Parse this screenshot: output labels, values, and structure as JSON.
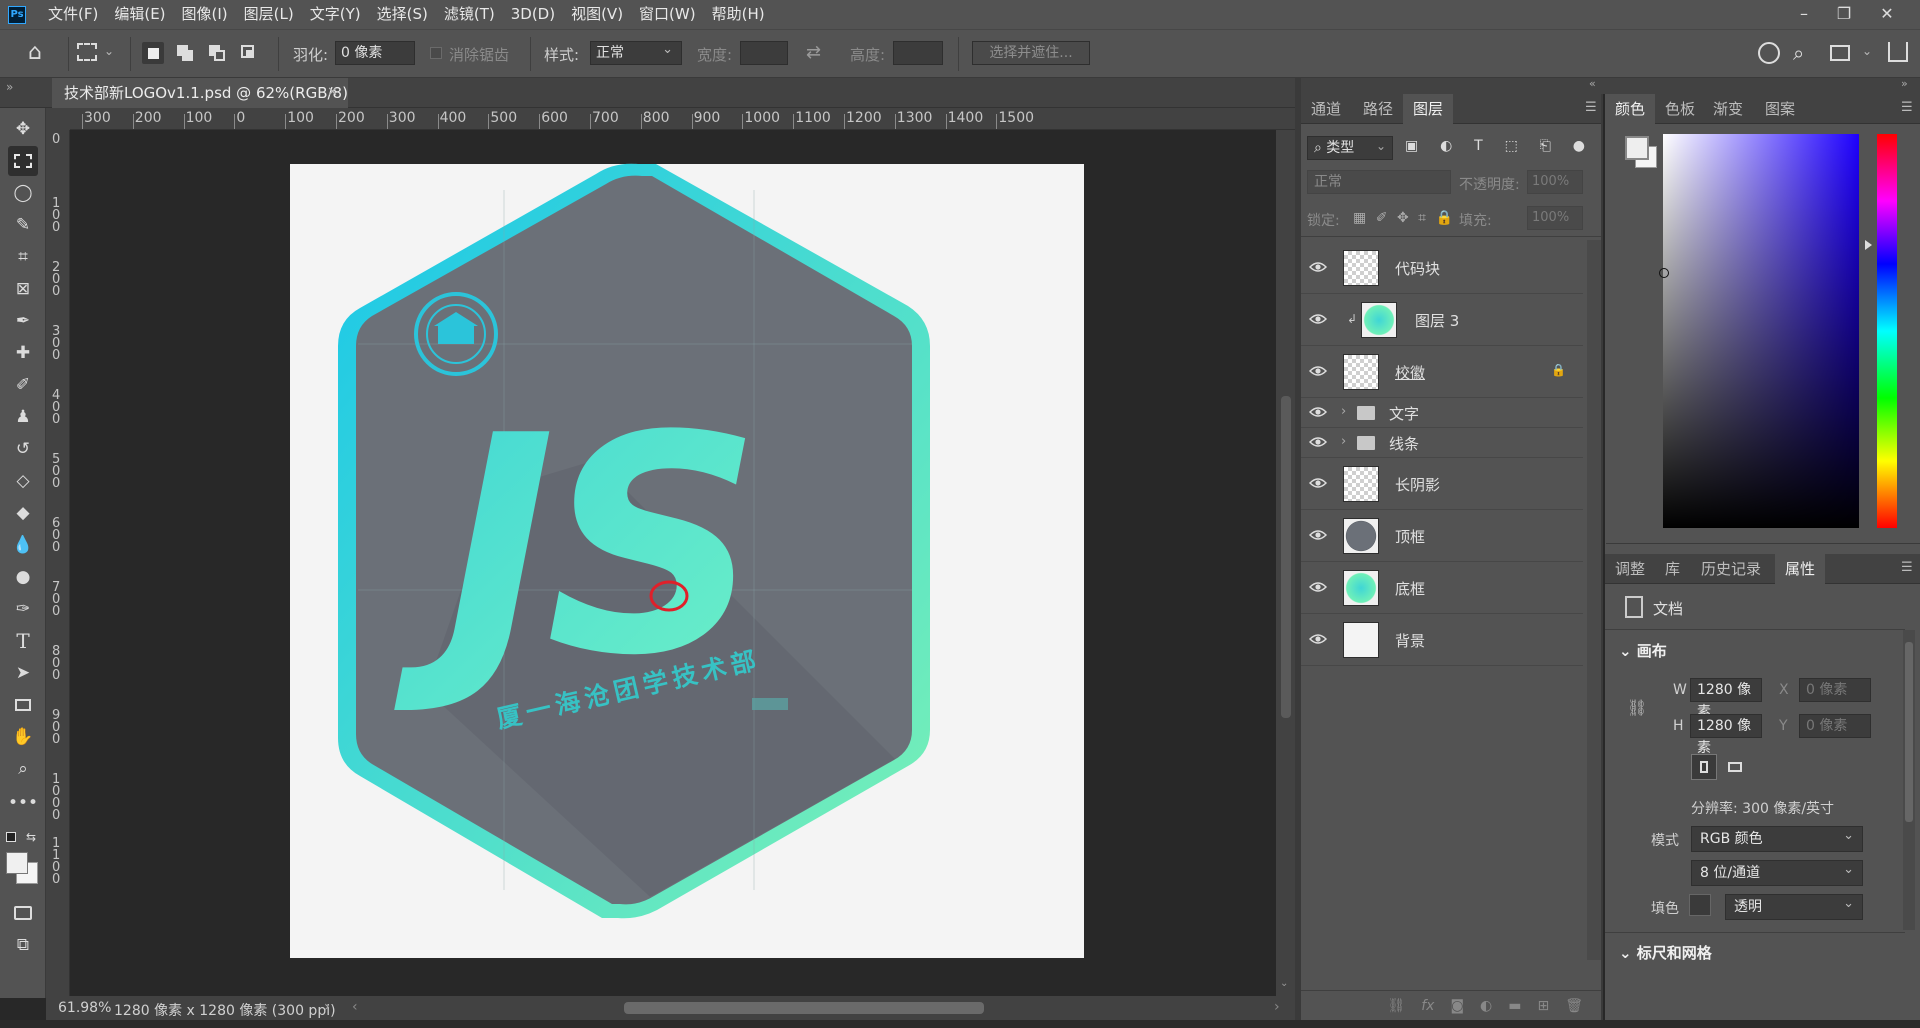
{
  "app": {
    "logo": "Ps"
  },
  "menu": [
    "文件(F)",
    "编辑(E)",
    "图像(I)",
    "图层(L)",
    "文字(Y)",
    "选择(S)",
    "滤镜(T)",
    "3D(D)",
    "视图(V)",
    "窗口(W)",
    "帮助(H)"
  ],
  "options": {
    "feather_label": "羽化:",
    "feather_value": "0 像素",
    "antialias_label": "消除锯齿",
    "style_label": "样式:",
    "style_value": "正常",
    "width_label": "宽度:",
    "height_label": "高度:",
    "select_mask_button": "选择并遮住..."
  },
  "document": {
    "tab_title": "技术部新LOGOv1.1.psd @ 62%(RGB/8)"
  },
  "ruler": {
    "h": [
      "300",
      "200",
      "100",
      "0",
      "100",
      "200",
      "300",
      "400",
      "500",
      "600",
      "700",
      "800",
      "900",
      "1000",
      "1100",
      "1200",
      "1300",
      "1400",
      "1500"
    ],
    "v": [
      "0",
      "1\n0\n0",
      "2\n0\n0",
      "3\n0\n0",
      "4\n0\n0",
      "5\n0\n0",
      "6\n0\n0",
      "7\n0\n0",
      "8\n0\n0",
      "9\n0\n0",
      "1\n0\n0\n0",
      "1\n1\n0\n0"
    ]
  },
  "artwork": {
    "logo_text": "JS",
    "subtitle": "厦一海沧团学技术部"
  },
  "status": {
    "zoom": "61.98%",
    "doc_info": "1280 像素 x 1280 像素 (300 ppi)"
  },
  "layers_panel": {
    "tabs": [
      "通道",
      "路径",
      "图层"
    ],
    "active_tab": "图层",
    "filter_type": "类型",
    "blend_mode": "正常",
    "opacity_label": "不透明度:",
    "opacity_value": "100%",
    "lock_label": "锁定:",
    "fill_label": "填充:",
    "fill_value": "100%",
    "layers": [
      {
        "name": "代码块",
        "thumb": "checker",
        "visible": true
      },
      {
        "name": "图层 3",
        "thumb": "gradient-hex",
        "visible": true,
        "clipped": true
      },
      {
        "name": "校徽",
        "thumb": "checker",
        "visible": true,
        "locked": true
      },
      {
        "name": "文字",
        "thumb": "folder",
        "visible": true
      },
      {
        "name": "线条",
        "thumb": "folder",
        "visible": true
      },
      {
        "name": "长阴影",
        "thumb": "checker",
        "visible": true
      },
      {
        "name": "顶框",
        "thumb": "gray-hex",
        "visible": true
      },
      {
        "name": "底框",
        "thumb": "gradient-hex",
        "visible": true
      },
      {
        "name": "背景",
        "thumb": "white",
        "visible": true
      }
    ]
  },
  "color_panel": {
    "tabs": [
      "颜色",
      "色板",
      "渐变",
      "图案"
    ],
    "active_tab": "颜色"
  },
  "properties_panel": {
    "tabs": [
      "调整",
      "库",
      "历史记录",
      "属性"
    ],
    "active_tab": "属性",
    "doc_label": "文档",
    "canvas_section": "画布",
    "w_label": "W",
    "w_value": "1280 像素",
    "h_label": "H",
    "h_value": "1280 像素",
    "x_label": "X",
    "x_placeholder": "0 像素",
    "y_label": "Y",
    "y_placeholder": "0 像素",
    "resolution": "分辨率: 300 像素/英寸",
    "mode_label": "模式",
    "mode_value": "RGB 颜色",
    "depth_value": "8 位/通道",
    "fill_label": "填色",
    "fill_value": "透明",
    "rulers_section": "标尺和网格"
  },
  "colors": {
    "teal": "#33d6e8",
    "mint": "#6ff0b8",
    "hex_fill": "#6b7078",
    "accent_red": "#e0202a"
  }
}
